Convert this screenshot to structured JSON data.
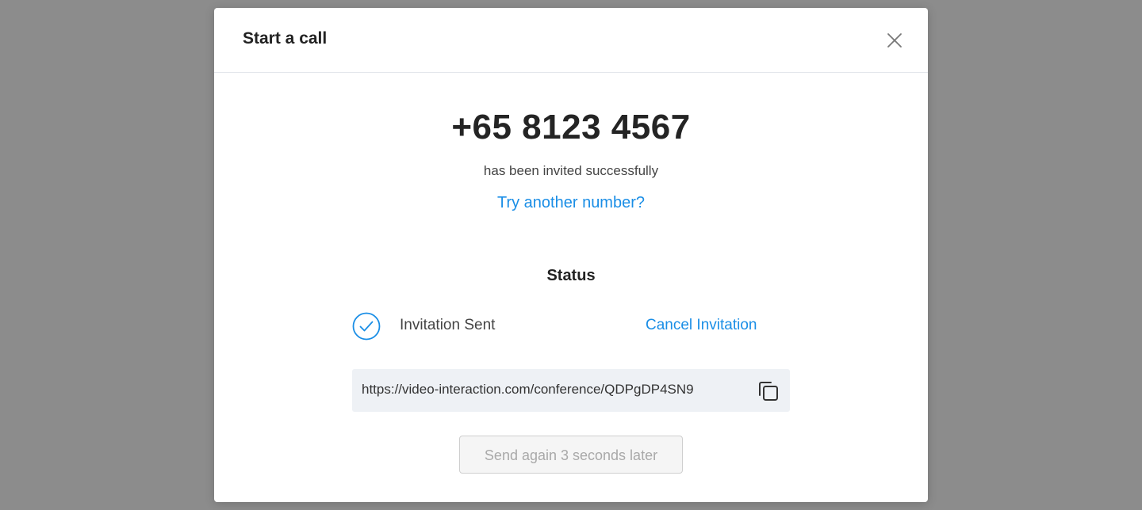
{
  "modal": {
    "title": "Start a call"
  },
  "invite": {
    "phone_number": "+65 8123 4567",
    "message": "has been invited successfully",
    "try_another_label": "Try another number?"
  },
  "status": {
    "title": "Status",
    "state_label": "Invitation Sent",
    "cancel_label": "Cancel Invitation"
  },
  "link": {
    "url": "https://video-interaction.com/conference/QDPgDP4SN9"
  },
  "send_again": {
    "label": "Send again 3 seconds later",
    "enabled": false
  },
  "icons": {
    "close": "close-icon",
    "check": "check-circle-icon",
    "copy": "copy-icon"
  },
  "colors": {
    "overlay": "#8c8c8c",
    "link": "#1a8ee6",
    "url_box_bg": "#eef1f5",
    "disabled_text": "#a9a9a9"
  }
}
